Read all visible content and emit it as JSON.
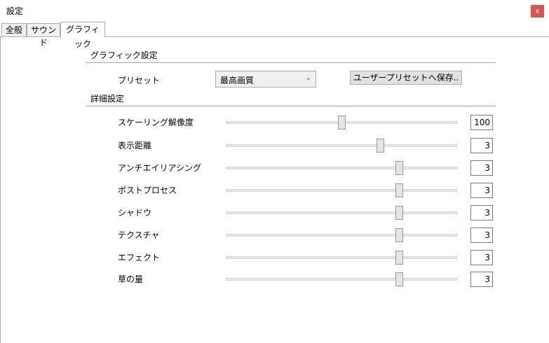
{
  "window": {
    "title": "設定",
    "close_label": "x"
  },
  "tabs": [
    {
      "label": "全般",
      "active": false
    },
    {
      "label": "サウンド",
      "active": false
    },
    {
      "label": "グラフィック",
      "active": true
    }
  ],
  "graphics": {
    "section_title": "グラフィック設定",
    "preset_label": "プリセット",
    "preset_value": "最高画質",
    "save_button_label": "ユーザープリセットへ保存..",
    "detail_title": "詳細設定",
    "settings": [
      {
        "label": "スケーリング解像度",
        "value": "100",
        "level": 0.5
      },
      {
        "label": "表示距離",
        "value": "3",
        "level": 0.667
      },
      {
        "label": "アンチエイリアシング",
        "value": "3",
        "level": 0.75
      },
      {
        "label": "ポストプロセス",
        "value": "3",
        "level": 0.75
      },
      {
        "label": "シャドウ",
        "value": "3",
        "level": 0.75
      },
      {
        "label": "テクスチャ",
        "value": "3",
        "level": 0.75
      },
      {
        "label": "エフェクト",
        "value": "3",
        "level": 0.75
      },
      {
        "label": "草の量",
        "value": "3",
        "level": 0.75
      }
    ]
  }
}
